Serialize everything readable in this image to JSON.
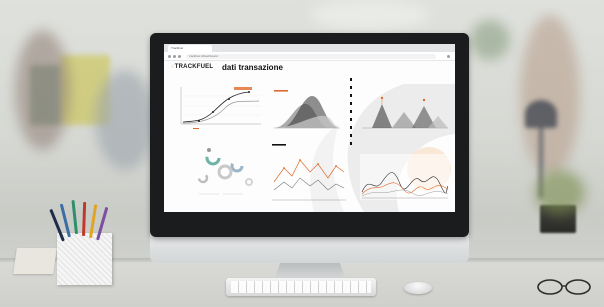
{
  "browser": {
    "tab_title": "Trackfuel",
    "url": "trackfuel.it/dashboard"
  },
  "app": {
    "logo_text": "TRACKFUEL",
    "logo_mark": "◌",
    "page_title": "dati transazione"
  },
  "icons": {
    "back": "arrow-left-icon",
    "forward": "arrow-right-icon",
    "reload": "reload-icon",
    "menu": "kebab-menu-icon"
  },
  "colors": {
    "accent": "#e06a2c",
    "dark": "#1a1a1a",
    "gray": "#8e8e8e",
    "teal": "#6fb3a9"
  }
}
